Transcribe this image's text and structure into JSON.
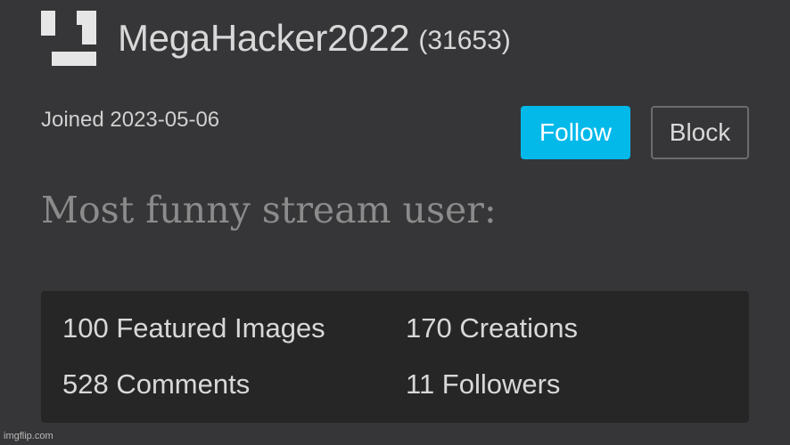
{
  "profile": {
    "username": "MegaHacker2022",
    "points": "(31653)",
    "joined": "Joined 2023-05-06",
    "bio": "Most funny stream user:"
  },
  "actions": {
    "follow_label": "Follow",
    "block_label": "Block"
  },
  "stats": {
    "featured_images": "100 Featured Images",
    "creations": "170 Creations",
    "comments": "528 Comments",
    "followers": "11 Followers"
  },
  "watermark": "imgflip.com",
  "colors": {
    "background": "#363638",
    "stats_panel": "#262627",
    "follow_button": "#03b9ea",
    "text": "#d8d8d8",
    "bio_text": "#8b8b8b"
  },
  "icons": {
    "avatar": "default-avatar-icon"
  }
}
